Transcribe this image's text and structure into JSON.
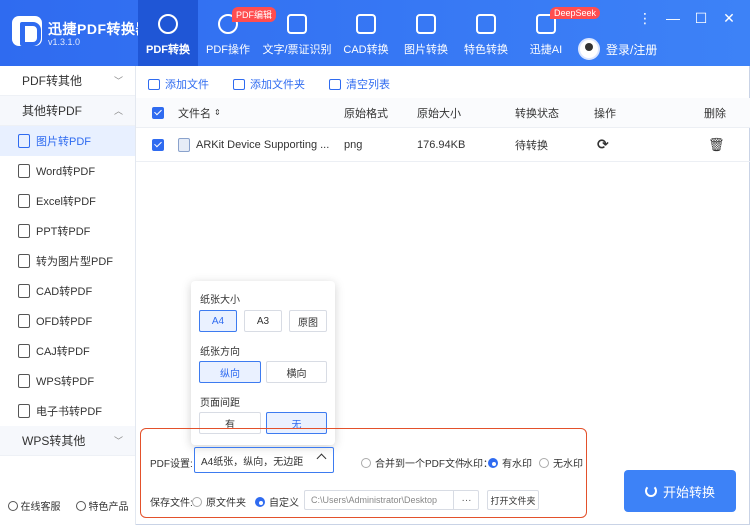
{
  "app": {
    "name": "迅捷PDF转换器",
    "version": "v1.3.1.0"
  },
  "nav": [
    {
      "label": "PDF转换",
      "icon": "convert-icon",
      "active": true
    },
    {
      "label": "PDF操作",
      "icon": "pdf-tools-icon",
      "badge": "PDF编辑"
    },
    {
      "label": "文字/票证识别",
      "icon": "ocr-icon"
    },
    {
      "label": "CAD转换",
      "icon": "cad-icon"
    },
    {
      "label": "图片转换",
      "icon": "image-icon"
    },
    {
      "label": "特色转换",
      "icon": "star-icon"
    },
    {
      "label": "迅捷AI",
      "icon": "ai-icon",
      "badge": "DeepSeek"
    }
  ],
  "user": {
    "login_label": "登录/注册"
  },
  "sidebar": {
    "group1": "PDF转其他",
    "group2": "其他转PDF",
    "items": [
      "图片转PDF",
      "Word转PDF",
      "Excel转PDF",
      "PPT转PDF",
      "转为图片型PDF",
      "CAD转PDF",
      "OFD转PDF",
      "CAJ转PDF",
      "WPS转PDF",
      "电子书转PDF"
    ],
    "group3": "WPS转其他",
    "service": "在线客服",
    "featured": "特色产品"
  },
  "toolbar": {
    "add_file": "添加文件",
    "add_folder": "添加文件夹",
    "clear_list": "清空列表"
  },
  "table": {
    "headers": {
      "name": "文件名",
      "format": "原始格式",
      "size": "原始大小",
      "status": "转换状态",
      "action": "操作",
      "delete": "删除"
    },
    "rows": [
      {
        "name": "ARKit Device Supporting ...",
        "format": "png",
        "size": "176.94KB",
        "status": "待转换"
      }
    ]
  },
  "popup": {
    "paper_size_label": "纸张大小",
    "paper_sizes": [
      "A4",
      "A3",
      "原图"
    ],
    "orientation_label": "纸张方向",
    "orientations": [
      "纵向",
      "横向"
    ],
    "margin_label": "页面间距",
    "margins": [
      "有",
      "无"
    ]
  },
  "settings": {
    "pdf_label": "PDF设置:",
    "pdf_value": "A4纸张，纵向，无边距",
    "merge_label": "合并到一个PDF文件",
    "watermark_label": "水印：",
    "watermark_yes": "有水印",
    "watermark_no": "无水印",
    "save_label": "保存文件:",
    "save_original": "原文件夹",
    "save_custom": "自定义",
    "path": "C:\\Users\\Administrator\\Desktop",
    "browse": "···",
    "open_folder": "打开文件夹"
  },
  "start_label": "开始转换"
}
